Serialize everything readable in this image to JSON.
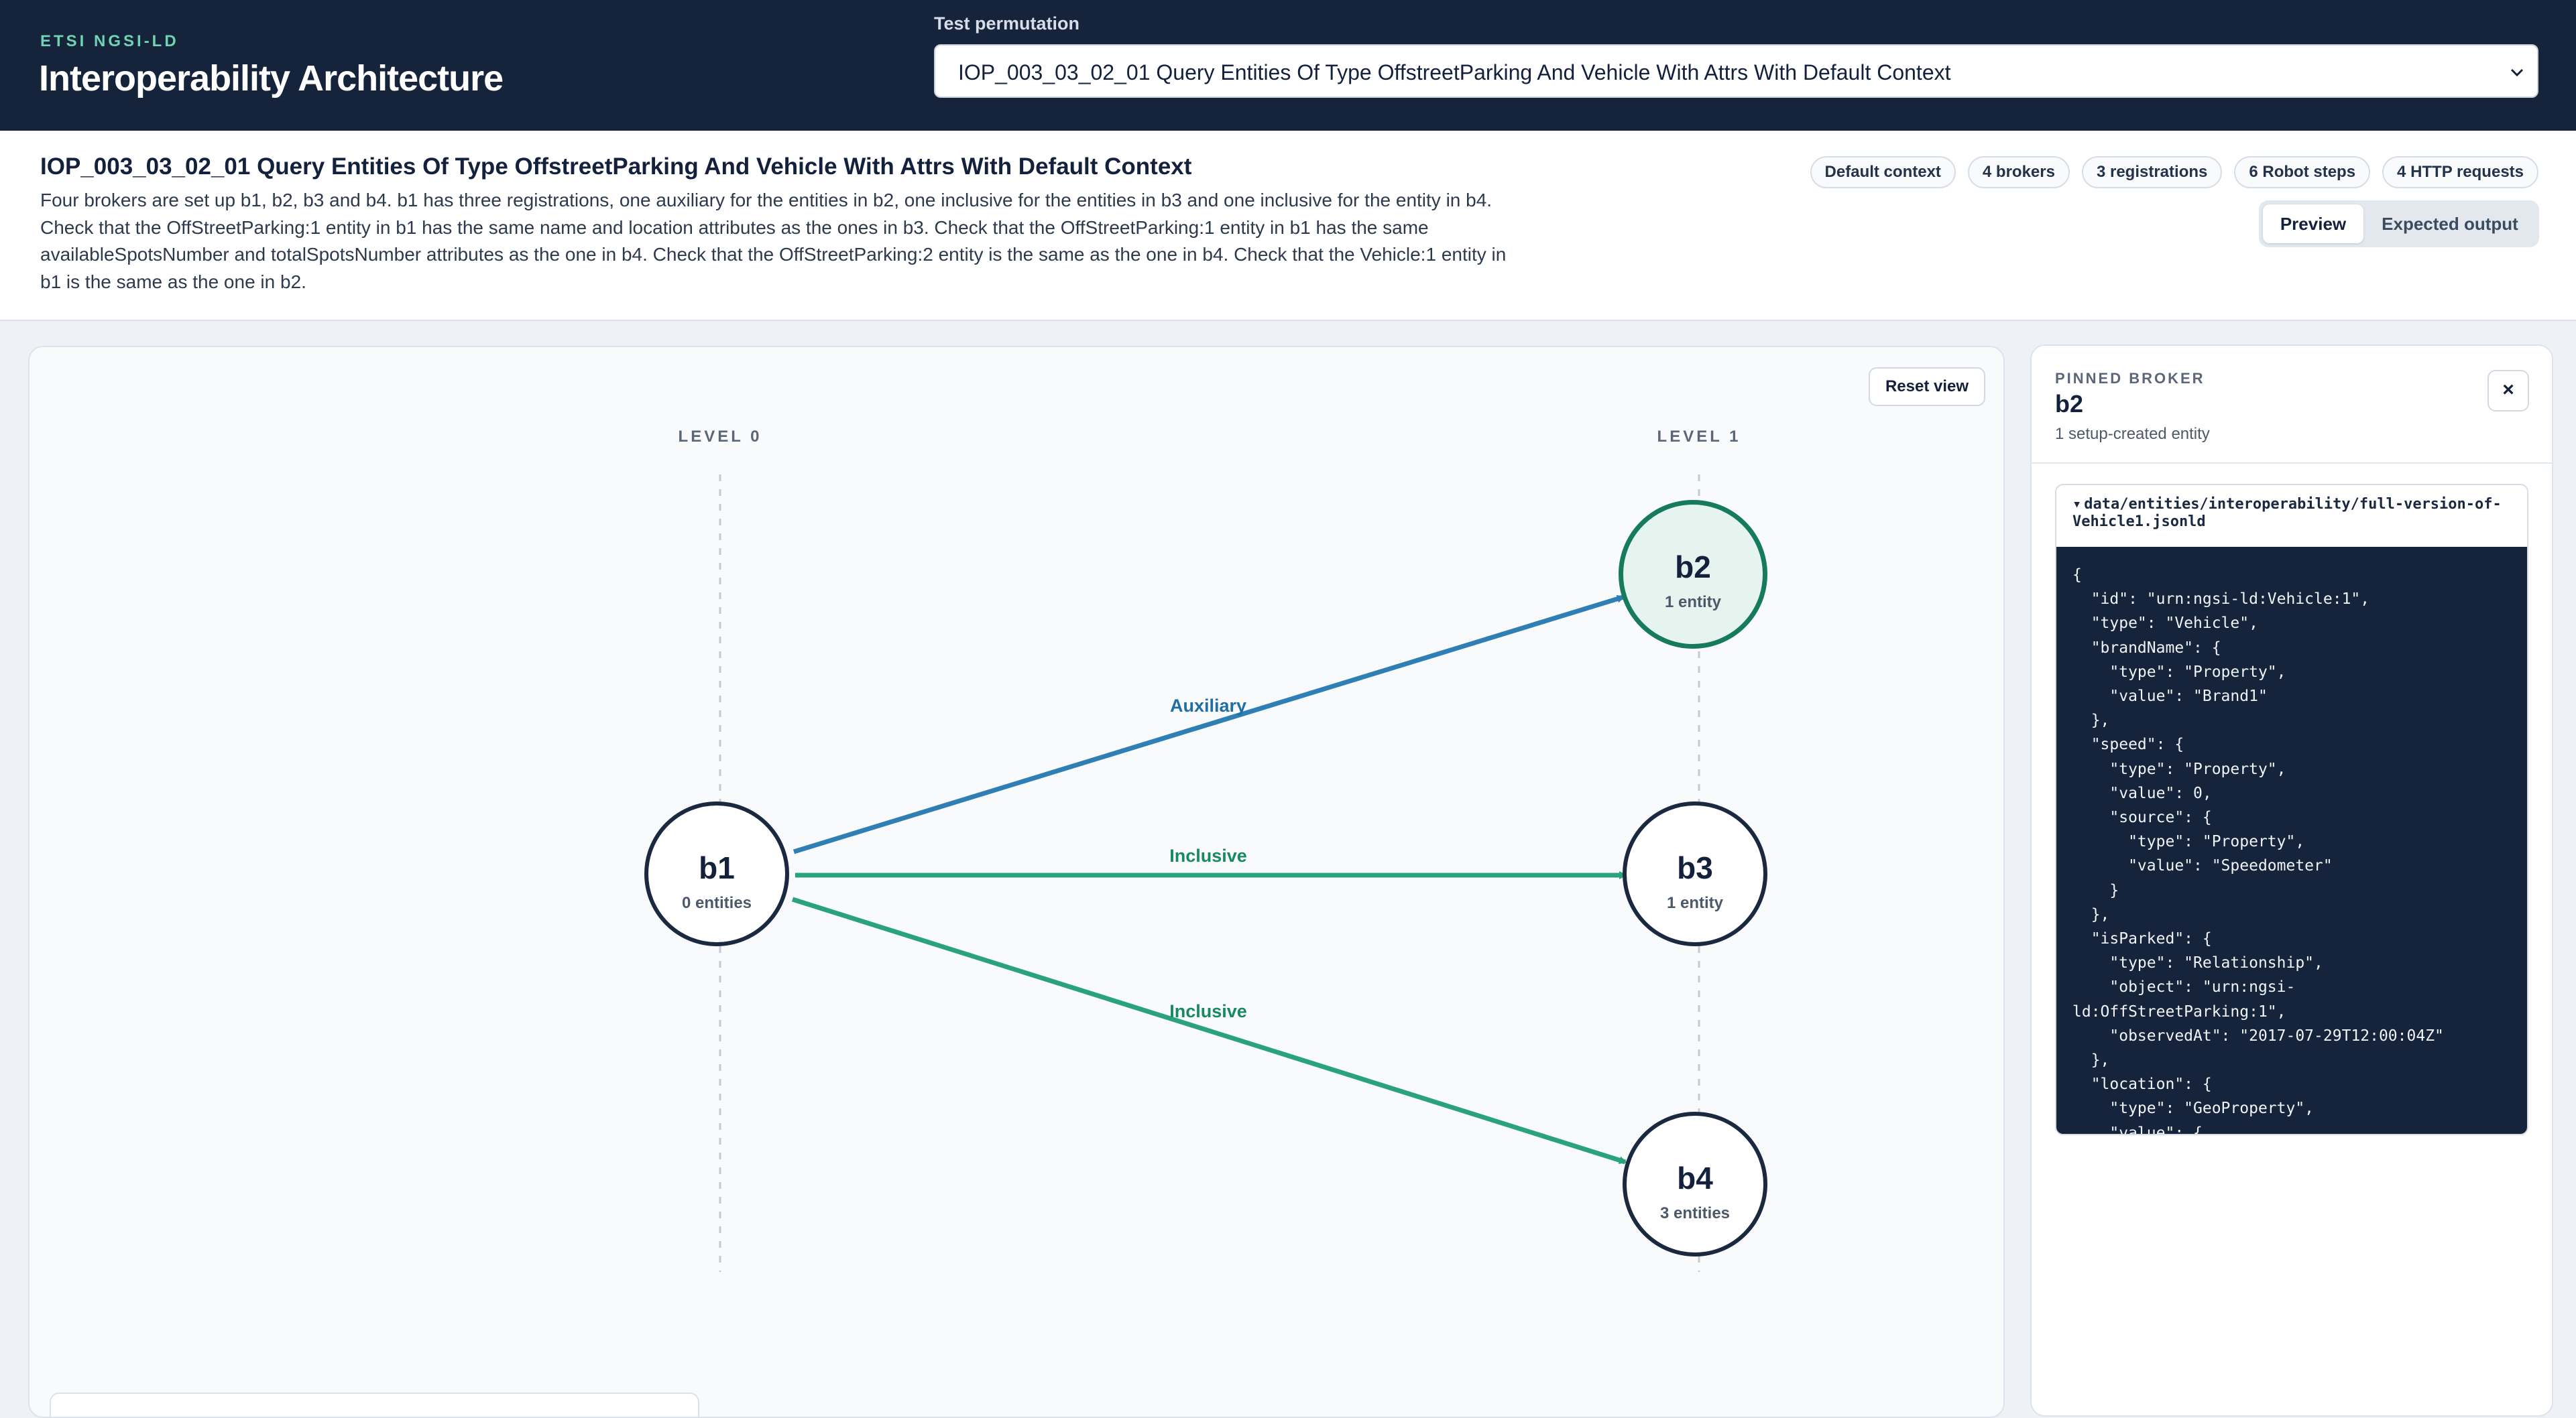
{
  "header": {
    "eyebrow": "ETSI NGSI-LD",
    "title": "Interoperability Architecture",
    "permutation_label": "Test permutation",
    "permutation_value": "IOP_003_03_02_01 Query Entities Of Type OffstreetParking And Vehicle With Attrs With Default Context"
  },
  "info": {
    "title": "IOP_003_03_02_01 Query Entities Of Type OffstreetParking And Vehicle With Attrs With Default Context",
    "description": "Four brokers are set up b1, b2, b3 and b4. b1 has three registrations, one auxiliary for the entities in b2, one inclusive for the entities in b3 and one inclusive for the entity in b4. Check that the OffStreetParking:1 entity in b1 has the same name and location attributes as the ones in b3. Check that the OffStreetParking:1 entity in b1 has the same availableSpotsNumber and totalSpotsNumber attributes as the one in b4. Check that the OffStreetParking:2 entity is the same as the one in b4. Check that the Vehicle:1 entity in b1 is the same as the one in b2.",
    "badges": [
      "Default context",
      "4 brokers",
      "3 registrations",
      "6 Robot steps",
      "4 HTTP requests"
    ],
    "view_toggle": {
      "preview": "Preview",
      "expected": "Expected output",
      "active": "Preview"
    }
  },
  "graph": {
    "reset_label": "Reset view",
    "levels": [
      "LEVEL 0",
      "LEVEL 1"
    ],
    "nodes": [
      {
        "id": "b1",
        "count": "0 entities",
        "level": 0,
        "pinned": false
      },
      {
        "id": "b2",
        "count": "1 entity",
        "level": 1,
        "pinned": true
      },
      {
        "id": "b3",
        "count": "1 entity",
        "level": 1,
        "pinned": false
      },
      {
        "id": "b4",
        "count": "3 entities",
        "level": 1,
        "pinned": false
      }
    ],
    "edges": [
      {
        "from": "b1",
        "to": "b2",
        "label": "Auxiliary",
        "color": "#2f7fb5"
      },
      {
        "from": "b1",
        "to": "b3",
        "label": "Inclusive",
        "color": "#2aa37c"
      },
      {
        "from": "b1",
        "to": "b4",
        "label": "Inclusive",
        "color": "#2aa37c"
      }
    ],
    "colors": {
      "auxiliary_label": "#1f6ea6",
      "inclusive_label": "#178a62"
    }
  },
  "inspector": {
    "eyebrow": "PINNED BROKER",
    "title": "b2",
    "subtitle": "1 setup-created entity",
    "close_label": "×",
    "file_toggle": "▾",
    "file_path": "data/entities/interoperability/full-version-of-Vehicle1.jsonld",
    "code_lines": [
      "{",
      "  \"id\": \"urn:ngsi-ld:Vehicle:1\",",
      "  \"type\": \"Vehicle\",",
      "  \"brandName\": {",
      "    \"type\": \"Property\",",
      "    \"value\": \"Brand1\"",
      "  },",
      "  \"speed\": {",
      "    \"type\": \"Property\",",
      "    \"value\": 0,",
      "    \"source\": {",
      "      \"type\": \"Property\",",
      "      \"value\": \"Speedometer\"",
      "    }",
      "  },",
      "  \"isParked\": {",
      "    \"type\": \"Relationship\",",
      "    \"object\": \"urn:ngsi-",
      "ld:OffStreetParking:1\",",
      "    \"observedAt\": \"2017-07-29T12:00:04Z\"",
      "  },",
      "  \"location\": {",
      "    \"type\": \"GeoProperty\",",
      "    \"value\": {"
    ]
  }
}
